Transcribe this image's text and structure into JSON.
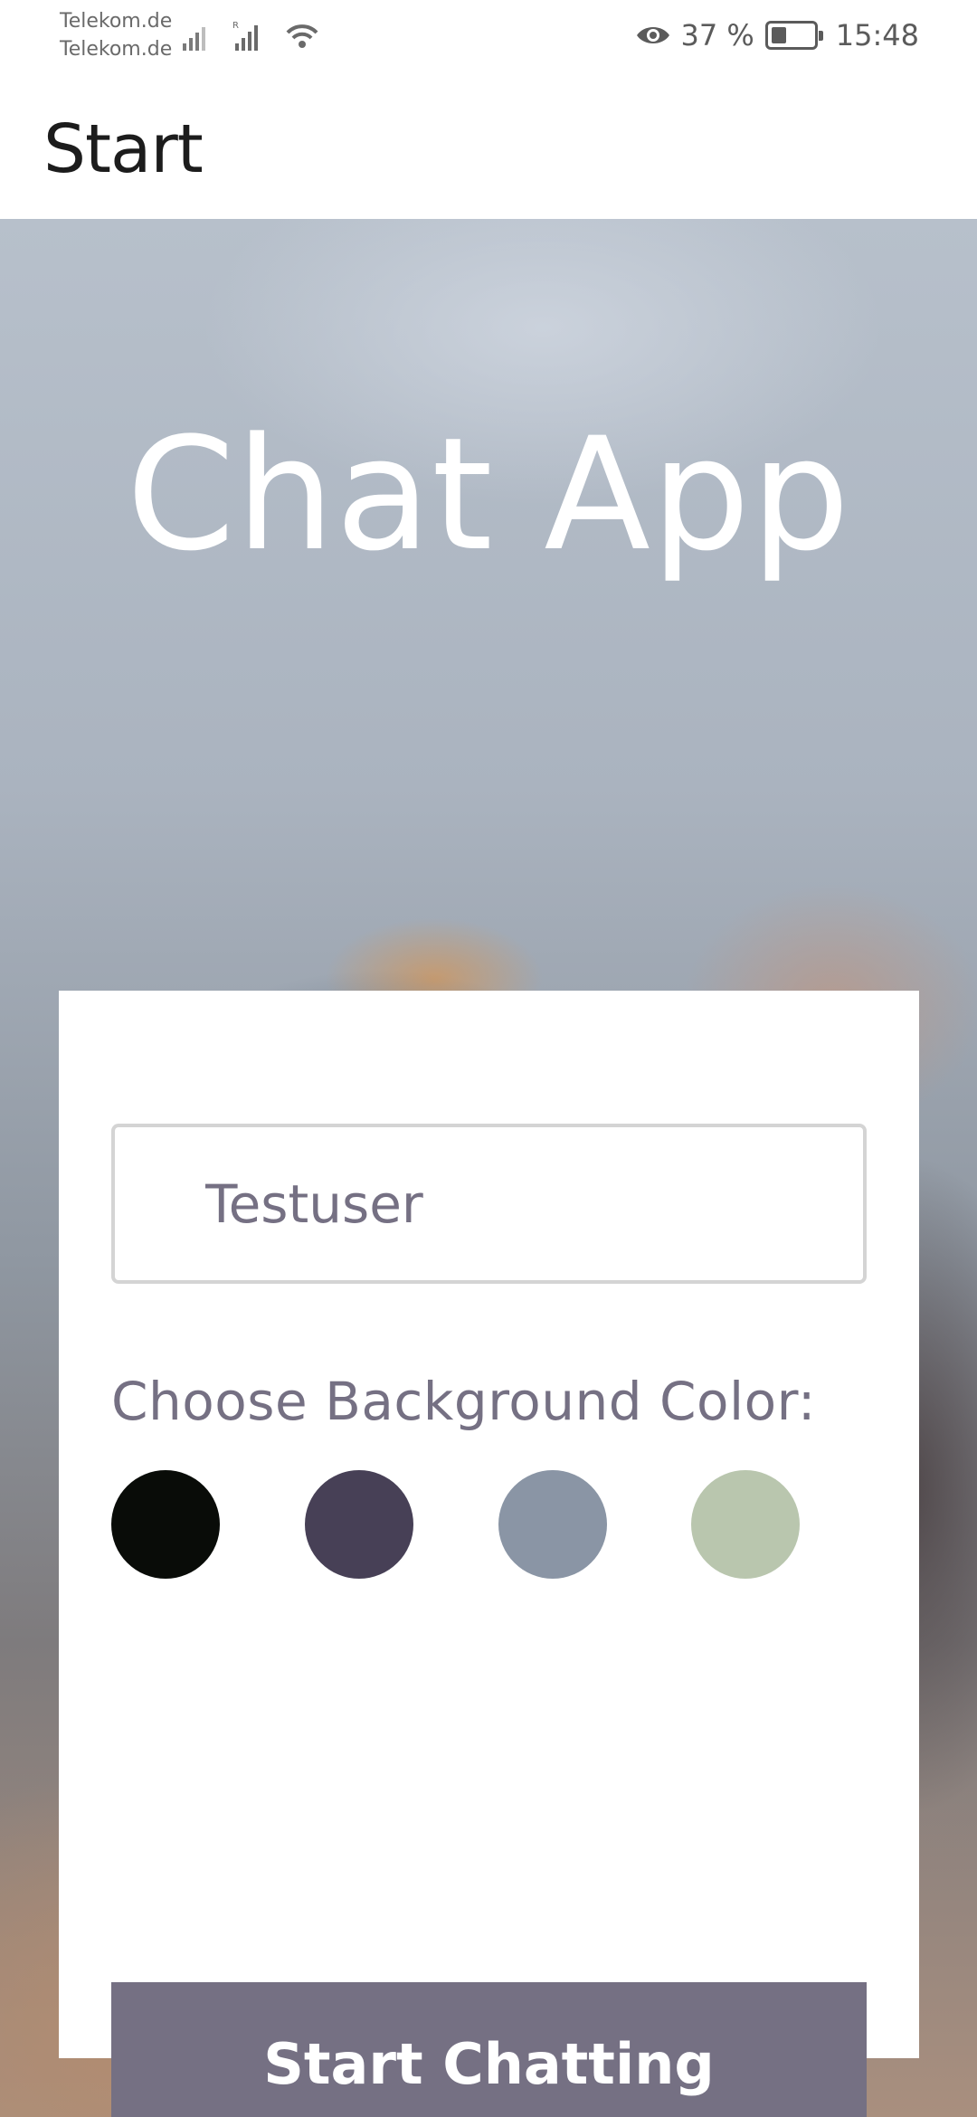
{
  "status_bar": {
    "carrier_1": "Telekom.de",
    "carrier_2": "Telekom.de",
    "battery_percent": "37 %",
    "battery_level": 0.37,
    "time": "15:48",
    "icons": [
      "signal-icon",
      "signal-roaming-icon",
      "wifi-icon",
      "eye-icon",
      "battery-icon"
    ]
  },
  "app_bar": {
    "title": "Start"
  },
  "hero": {
    "title": "Chat App"
  },
  "form": {
    "name_input_value": "Testuser",
    "color_label": "Choose Background Color:",
    "colors": [
      "#090C08",
      "#474056",
      "#8A95A5",
      "#B9C6AE"
    ],
    "button_label": "Start Chatting",
    "button_color": "#757083"
  }
}
